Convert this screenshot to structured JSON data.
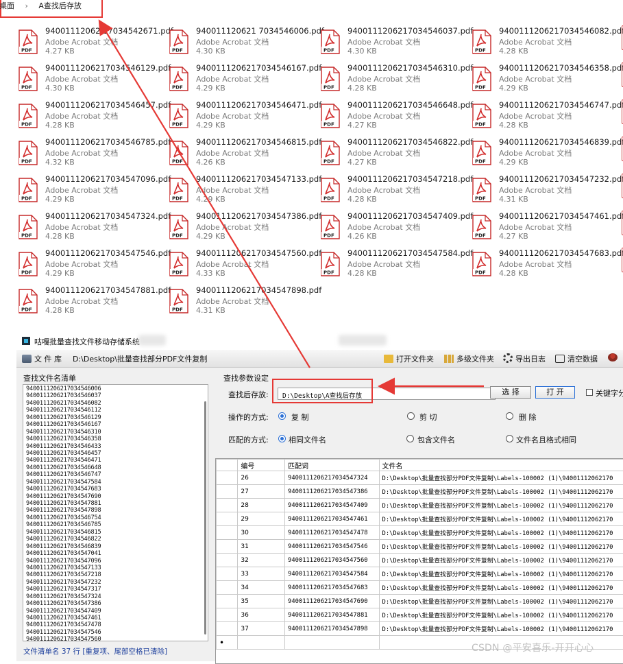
{
  "explorer": {
    "breadcrumb": {
      "root": "桌面",
      "separator": "›",
      "folder": "A查找后存放"
    },
    "file_type": "Adobe Acrobat 文档",
    "icon_label": "PDF",
    "files": [
      {
        "name": "94001112062 17034542671.pdf",
        "size": "4.27 KB"
      },
      {
        "name": "940011120621 7034546006.pdf",
        "size": "4.30 KB"
      },
      {
        "name": "9400111206217034546037.pdf",
        "size": "4.30 KB"
      },
      {
        "name": "9400111206217034546082.pdf",
        "size": "4.28 KB"
      },
      {
        "name": "9400111206217034546129.pdf",
        "size": "4.30 KB"
      },
      {
        "name": "9400111206217034546167.pdf",
        "size": "4.29 KB"
      },
      {
        "name": "9400111206217034546310.pdf",
        "size": "4.28 KB"
      },
      {
        "name": "9400111206217034546358.pdf",
        "size": "4.29 KB"
      },
      {
        "name": "9400111206217034546457.pdf",
        "size": "4.28 KB"
      },
      {
        "name": "9400111206217034546471.pdf",
        "size": "4.29 KB"
      },
      {
        "name": "9400111206217034546648.pdf",
        "size": "4.27 KB"
      },
      {
        "name": "9400111206217034546747.pdf",
        "size": "4.28 KB"
      },
      {
        "name": "9400111206217034546785.pdf",
        "size": "4.32 KB"
      },
      {
        "name": "9400111206217034546815.pdf",
        "size": "4.26 KB"
      },
      {
        "name": "9400111206217034546822.pdf",
        "size": "4.27 KB"
      },
      {
        "name": "9400111206217034546839.pdf",
        "size": "4.29 KB"
      },
      {
        "name": "9400111206217034547096.pdf",
        "size": "4.29 KB"
      },
      {
        "name": "9400111206217034547133.pdf",
        "size": "4.29 KB"
      },
      {
        "name": "9400111206217034547218.pdf",
        "size": "4.28 KB"
      },
      {
        "name": "9400111206217034547232.pdf",
        "size": "4.31 KB"
      },
      {
        "name": "9400111206217034547324.pdf",
        "size": "4.28 KB"
      },
      {
        "name": "9400111206217034547386.pdf",
        "size": "4.29 KB"
      },
      {
        "name": "9400111206217034547409.pdf",
        "size": "4.26 KB"
      },
      {
        "name": "9400111206217034547461.pdf",
        "size": "4.27 KB"
      },
      {
        "name": "9400111206217034547546.pdf",
        "size": "4.29 KB"
      },
      {
        "name": "9400111206217034547560.pdf",
        "size": "4.33 KB"
      },
      {
        "name": "9400111206217034547584.pdf",
        "size": "4.28 KB"
      },
      {
        "name": "9400111206217034547683.pdf",
        "size": "4.28 KB"
      },
      {
        "name": "9400111206217034547881.pdf",
        "size": "4.28 KB"
      },
      {
        "name": "9400111206217034547898.pdf",
        "size": "4.31 KB"
      }
    ]
  },
  "app": {
    "title": "咕嘎批量查找文件移动存储系统",
    "toolbar": {
      "library_label": "文 件 库",
      "library_path": "D:\\Desktop\\批量查找部分PDF文件复制",
      "open_folder": "打开文件夹",
      "multi_folder": "多级文件夹",
      "export_log": "导出日志",
      "clear_data": "清空数据"
    },
    "left": {
      "title": "查找文件名清单",
      "list": [
        "9400111206217034546006",
        "9400111206217034546037",
        "9400111206217034546082",
        "9400111206217034546112",
        "9400111206217034546129",
        "9400111206217034546167",
        "9400111206217034546310",
        "9400111206217034546358",
        "9400111206217034546433",
        "9400111206217034546457",
        "9400111206217034546471",
        "9400111206217034546648",
        "9400111206217034546747",
        "9400111206217034547584",
        "9400111206217034547683",
        "9400111206217034547690",
        "9400111206217034547881",
        "9400111206217034547898",
        "9400111206217034546754",
        "9400111206217034546785",
        "9400111206217034546815",
        "9400111206217034546822",
        "9400111206217034546839",
        "9400111206217034547041",
        "9400111206217034547096",
        "9400111206217034547133",
        "9400111206217034547218",
        "9400111206217034547232",
        "9400111206217034547317",
        "9400111206217034547324",
        "9400111206217034547386",
        "9400111206217034547409",
        "9400111206217034547461",
        "9400111206217034547478",
        "9400111206217034547546",
        "9400111206217034547560"
      ],
      "status": "文件清单名 37 行  [重复项、尾部空格已清除]"
    },
    "right": {
      "title": "查找参数设定",
      "save_label": "查找后存放:",
      "save_path": "D:\\Desktop\\A查找后存放",
      "choose_button": "选 择",
      "open_button": "打 开",
      "keyword_label": "关键字分",
      "op_label": "操作的方式:",
      "op_options": [
        "复 制",
        "剪 切",
        "删 除"
      ],
      "match_label": "匹配的方式:",
      "match_options": [
        "相同文件名",
        "包含文件名",
        "文件名且格式相同"
      ],
      "grid": {
        "headers": [
          "编号",
          "匹配词",
          "文件名"
        ],
        "path_prefix": "D:\\Desktop\\批量查找部分PDF文件复制\\Labels-100002 (1)\\94001112062170",
        "rows": [
          {
            "no": "26",
            "word": "9400111206217034547324"
          },
          {
            "no": "27",
            "word": "9400111206217034547386"
          },
          {
            "no": "28",
            "word": "9400111206217034547409"
          },
          {
            "no": "29",
            "word": "9400111206217034547461"
          },
          {
            "no": "30",
            "word": "9400111206217034547478"
          },
          {
            "no": "31",
            "word": "9400111206217034547546"
          },
          {
            "no": "32",
            "word": "9400111206217034547560"
          },
          {
            "no": "33",
            "word": "9400111206217034547584"
          },
          {
            "no": "34",
            "word": "9400111206217034547683"
          },
          {
            "no": "35",
            "word": "9400111206217034547690"
          },
          {
            "no": "36",
            "word": "9400111206217034547881"
          },
          {
            "no": "37",
            "word": "9400111206217034547898"
          }
        ],
        "new_row_marker": "•"
      }
    }
  },
  "watermark": "CSDN @平安喜乐-开开心心",
  "colors": {
    "annotation_red": "#e53935",
    "link_blue": "#1d3f9c",
    "radio_blue": "#2a6fd6"
  }
}
